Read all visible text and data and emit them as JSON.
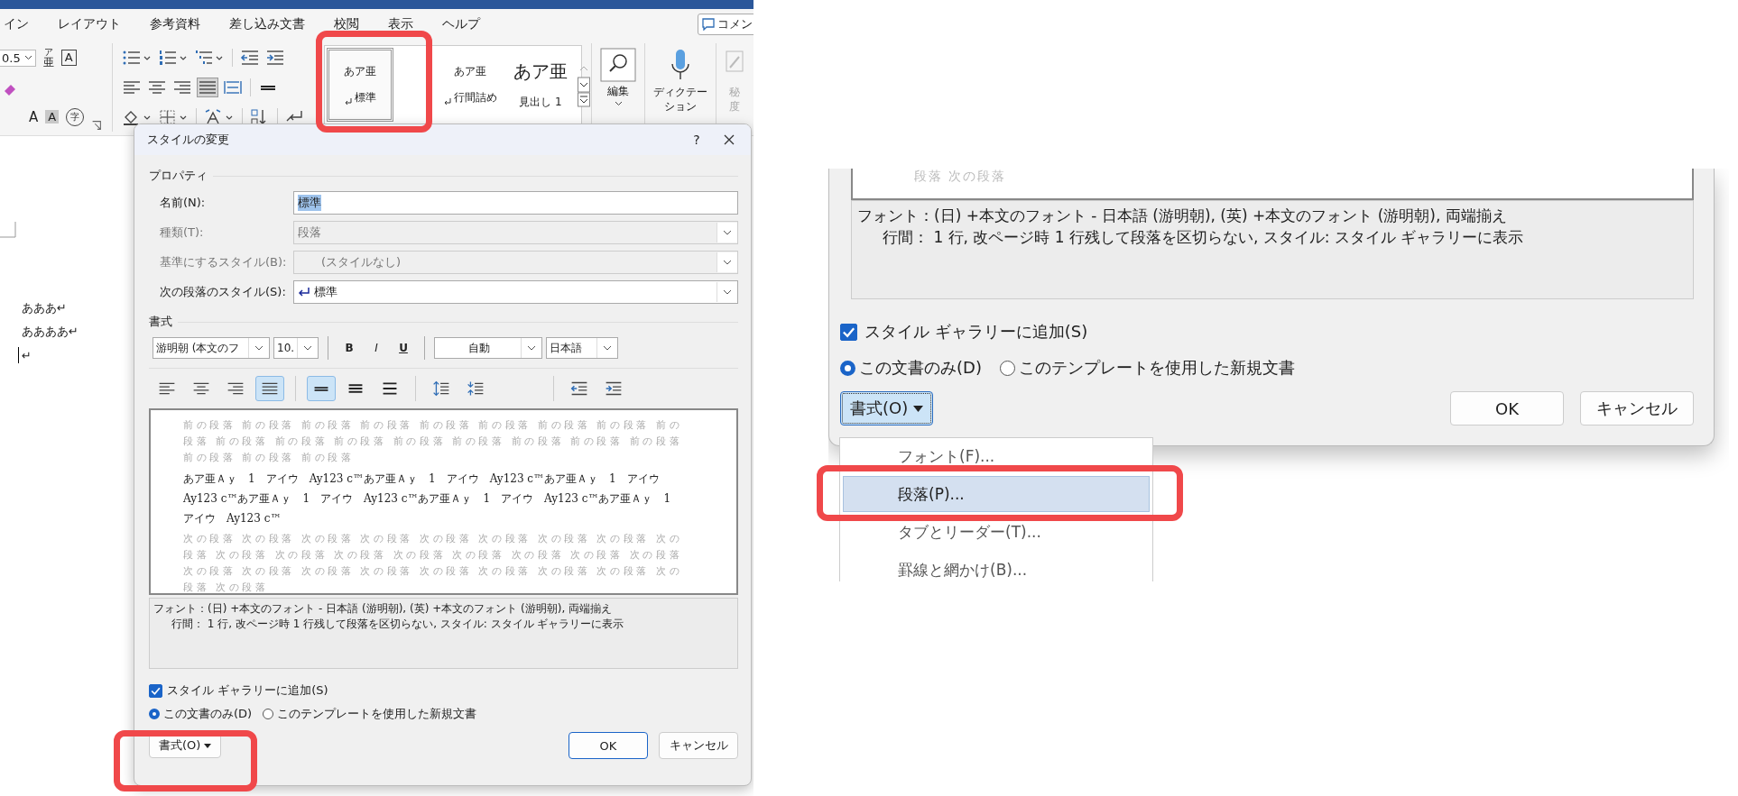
{
  "ribbon": {
    "tabs": [
      {
        "label": "イン",
        "selected": false
      },
      {
        "label": "レイアウト",
        "selected": false
      },
      {
        "label": "参考資料",
        "selected": false
      },
      {
        "label": "差し込み文書",
        "selected": false
      },
      {
        "label": "校閲",
        "selected": false
      },
      {
        "label": "表示",
        "selected": false
      },
      {
        "label": "ヘルプ",
        "selected": false
      }
    ],
    "comment_button": "コメン",
    "font_size": "0.5",
    "glyph_buttons": [
      {
        "kind": "ruby",
        "text": "亜",
        "ruby": "ア"
      },
      {
        "kind": "boxed",
        "text": "A"
      },
      {
        "kind": "grow",
        "text": "A"
      },
      {
        "kind": "shaded",
        "text": "A"
      },
      {
        "kind": "circled",
        "text": "字"
      }
    ],
    "styles": [
      {
        "sample": "あア亜",
        "name": "標準",
        "kind": "paragraph",
        "selected": true
      },
      {
        "sample": "あア亜",
        "name": "行間詰め",
        "kind": "paragraph",
        "selected": false
      },
      {
        "sample": "あア亜",
        "name": "見出し 1",
        "kind": "heading",
        "selected": false
      }
    ],
    "edit_button": "編集",
    "dictation_lines": [
      "ディクテー",
      "ション"
    ],
    "sensitivity_lines": [
      "秘",
      "度"
    ]
  },
  "document": {
    "lines": [
      "あああ↵",
      "ああああ↵",
      "↵"
    ]
  },
  "dialog": {
    "title": "スタイルの変更",
    "help": "?",
    "properties_heading": "プロパティ",
    "fields": [
      {
        "label": "名前(N):",
        "value": "標準",
        "kind": "text",
        "disabled": false,
        "highlighted": true,
        "style_mark": false
      },
      {
        "label": "種類(T):",
        "value": "段落",
        "kind": "select",
        "disabled": true,
        "highlighted": false,
        "style_mark": false
      },
      {
        "label": "基準にするスタイル(B):",
        "value": "(スタイルなし)",
        "kind": "select",
        "disabled": true,
        "highlighted": false,
        "style_mark": false
      },
      {
        "label": "次の段落のスタイル(S):",
        "value": "標準",
        "kind": "select",
        "disabled": false,
        "highlighted": false,
        "style_mark": true
      }
    ],
    "formatting_heading": "書式",
    "font": "游明朝 (本文のフ",
    "size": "10.",
    "style_buttons": [
      {
        "label": "B",
        "kind": "bold"
      },
      {
        "label": "I",
        "kind": "italic"
      },
      {
        "label": "U",
        "kind": "underline"
      }
    ],
    "font_color": "自動",
    "language": "日本語",
    "alignment": [
      {
        "kind": "left",
        "selected": false
      },
      {
        "kind": "center",
        "selected": false
      },
      {
        "kind": "right",
        "selected": false
      },
      {
        "kind": "justify",
        "selected": true
      }
    ],
    "line_spacing": [
      {
        "kind": "single",
        "selected": true
      },
      {
        "kind": "onehalf",
        "selected": false
      },
      {
        "kind": "double",
        "selected": false
      }
    ],
    "paragraph_spacing": [
      {
        "kind": "increase"
      },
      {
        "kind": "decrease"
      }
    ],
    "indent": [
      {
        "kind": "outdent"
      },
      {
        "kind": "indent"
      }
    ],
    "preview": {
      "previous_lines": [
        "前の段落 前の段落 前の段落 前の段落 前の段落 前の段落 前の段落 前の段落 前の",
        "段落 前の段落 前の段落 前の段落 前の段落 前の段落 前の段落 前の段落 前の段落",
        "前の段落 前の段落 前の段落"
      ],
      "sample": "あア亜Ａｙ　1　アイウ　Ay123 c™あア亜Ａｙ　1　アイウ　Ay123 c™あア亜Ａｙ　1　アイウ　Ay123 c™あア亜Ａｙ　1　アイウ　Ay123 c™あア亜Ａｙ　1　アイウ　Ay123 c™あア亜Ａｙ　1　アイウ　Ay123 c™",
      "next_lines": [
        "次の段落 次の段落 次の段落 次の段落 次の段落 次の段落 次の段落 次の段落 次の",
        "段落 次の段落 次の段落 次の段落 次の段落 次の段落 次の段落 次の段落 次の段落",
        "次の段落 次の段落 次の段落 次の段落 次の段落 次の段落 次の段落 次の段落 次の",
        "段落 次の段落"
      ]
    },
    "description": [
      "フォント：(日) +本文のフォント - 日本語 (游明朝), (英) +本文のフォント (游明朝), 両端揃え",
      "行間： 1 行, 改ページ時 1 行残して段落を区切らない, スタイル: スタイル ギャラリーに表示"
    ],
    "gallery_checkbox": {
      "label": "スタイル ギャラリーに追加(S)",
      "checked": true
    },
    "scope": [
      {
        "label": "この文書のみ(D)",
        "selected": true
      },
      {
        "label": "このテンプレートを使用した新規文書",
        "selected": false
      }
    ],
    "format_button": {
      "label": "書式(O)",
      "open": false
    },
    "ok": "OK",
    "cancel": "キャンセル"
  },
  "zoomed_dialog": {
    "preview_tail": "段落 次の段落",
    "description": [
      "フォント：(日) +本文のフォント - 日本語 (游明朝), (英) +本文のフォント (游明朝), 両端揃え",
      "行間： 1 行, 改ページ時 1 行残して段落を区切らない, スタイル: スタイル ギャラリーに表示"
    ],
    "gallery_checkbox": {
      "label": "スタイル ギャラリーに追加(S)",
      "checked": true
    },
    "scope": [
      {
        "label": "この文書のみ(D)",
        "selected": true
      },
      {
        "label": "このテンプレートを使用した新規文書",
        "selected": false
      }
    ],
    "format_button": {
      "label": "書式(O)",
      "open": true
    },
    "ok": "OK",
    "cancel": "キャンセル",
    "format_menu": [
      {
        "label": "フォント(F)...",
        "selected": false
      },
      {
        "label": "段落(P)...",
        "selected": true
      },
      {
        "label": "タブとリーダー(T)...",
        "selected": false
      },
      {
        "label": "罫線と網かけ(B)...",
        "selected": false
      }
    ]
  }
}
